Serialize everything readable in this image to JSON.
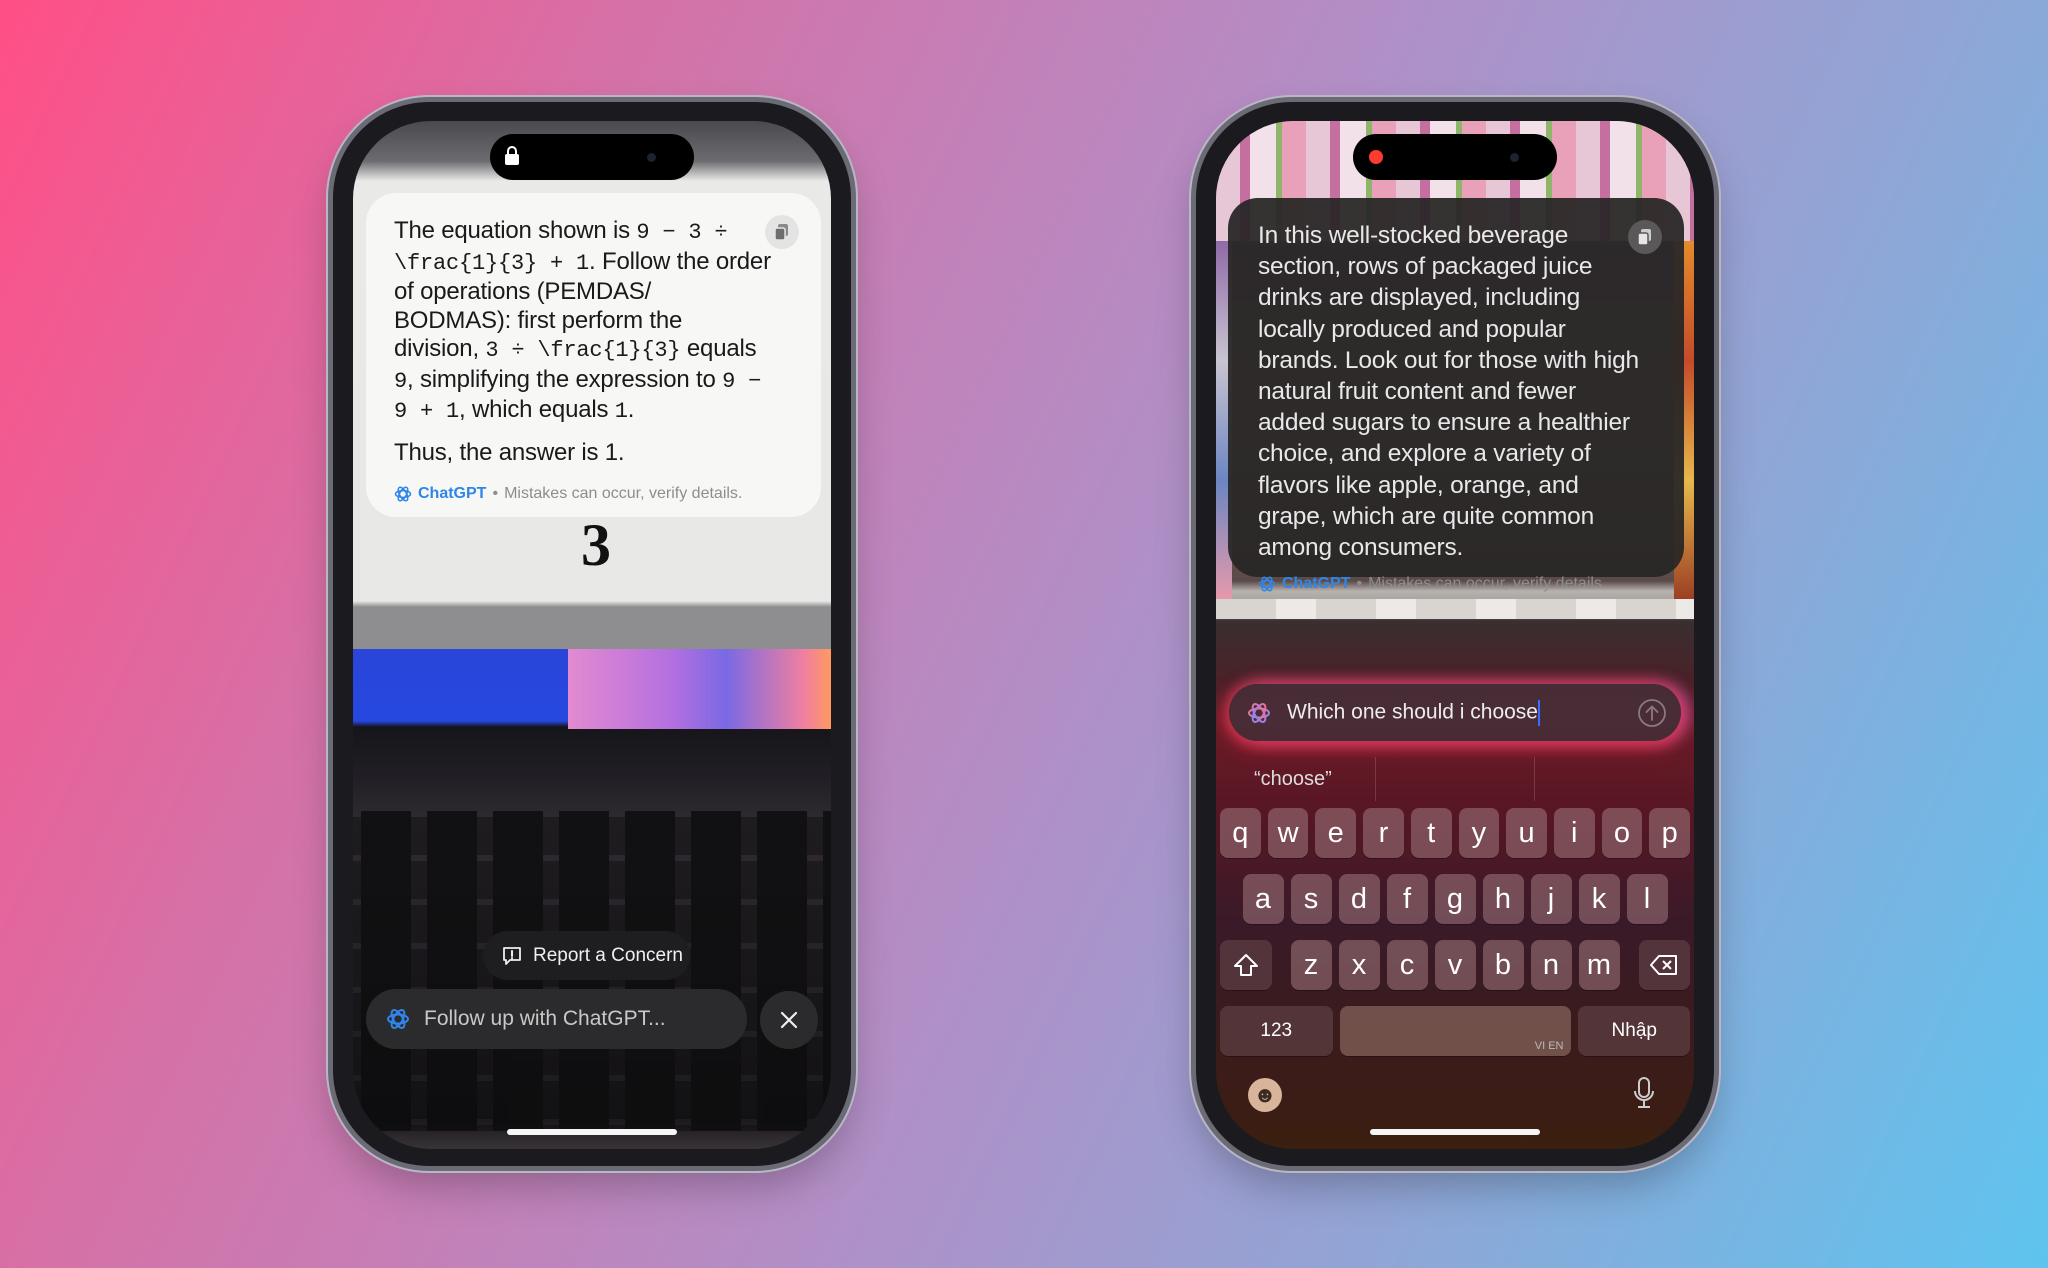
{
  "left_phone": {
    "card": {
      "paragraph1": [
        {
          "t": "text",
          "v": "The equation shown is "
        },
        {
          "t": "mono",
          "v": "9 − 3 ÷ \\frac{1}{3} + 1"
        },
        {
          "t": "text",
          "v": ". Follow the order of operations (PEMDAS/ BODMAS): first perform the division, "
        },
        {
          "t": "mono",
          "v": "3 ÷ \\frac{1}{3}"
        },
        {
          "t": "text",
          "v": " equals "
        },
        {
          "t": "mono",
          "v": "9"
        },
        {
          "t": "text",
          "v": ", simplifying the expression to "
        },
        {
          "t": "mono",
          "v": "9 − 9 + 1"
        },
        {
          "t": "text",
          "v": ", which equals "
        },
        {
          "t": "mono",
          "v": "1"
        },
        {
          "t": "text",
          "v": "."
        }
      ],
      "paragraph2": "Thus, the answer is 1.",
      "brand": "ChatGPT",
      "separator": "•",
      "disclaimer": "Mistakes can occur, verify details.",
      "copy_icon": "copy-icon"
    },
    "photo_digit": "3",
    "report_label": "Report a Concern",
    "followup_placeholder": "Follow up with ChatGPT...",
    "close_icon": "close-icon"
  },
  "right_phone": {
    "card": {
      "text": "In this well-stocked beverage section, rows of packaged juice drinks are displayed, including locally produced and popular brands. Look out for those with high natural fruit content and fewer added sugars to ensure a healthier choice, and explore a variety of flavors like apple, orange, and grape, which are quite common among consumers.",
      "brand": "ChatGPT",
      "separator": "•",
      "disclaimer": "Mistakes can occur, verify details."
    },
    "input_value": "Which one should i choose",
    "suggestions": [
      "“choose”",
      "",
      ""
    ],
    "keyboard": {
      "row1": [
        "q",
        "w",
        "e",
        "r",
        "t",
        "y",
        "u",
        "i",
        "o",
        "p"
      ],
      "row2": [
        "a",
        "s",
        "d",
        "f",
        "g",
        "h",
        "j",
        "k",
        "l"
      ],
      "row3": [
        "z",
        "x",
        "c",
        "v",
        "b",
        "n",
        "m"
      ],
      "numbers_label": "123",
      "space_hint": "VI EN",
      "enter_label": "Nhập"
    }
  },
  "colors": {
    "accent_blue": "#2f86e8",
    "glow": "#ff3c5a",
    "background_start": "#ff4f86",
    "background_end": "#5ec4ef"
  }
}
